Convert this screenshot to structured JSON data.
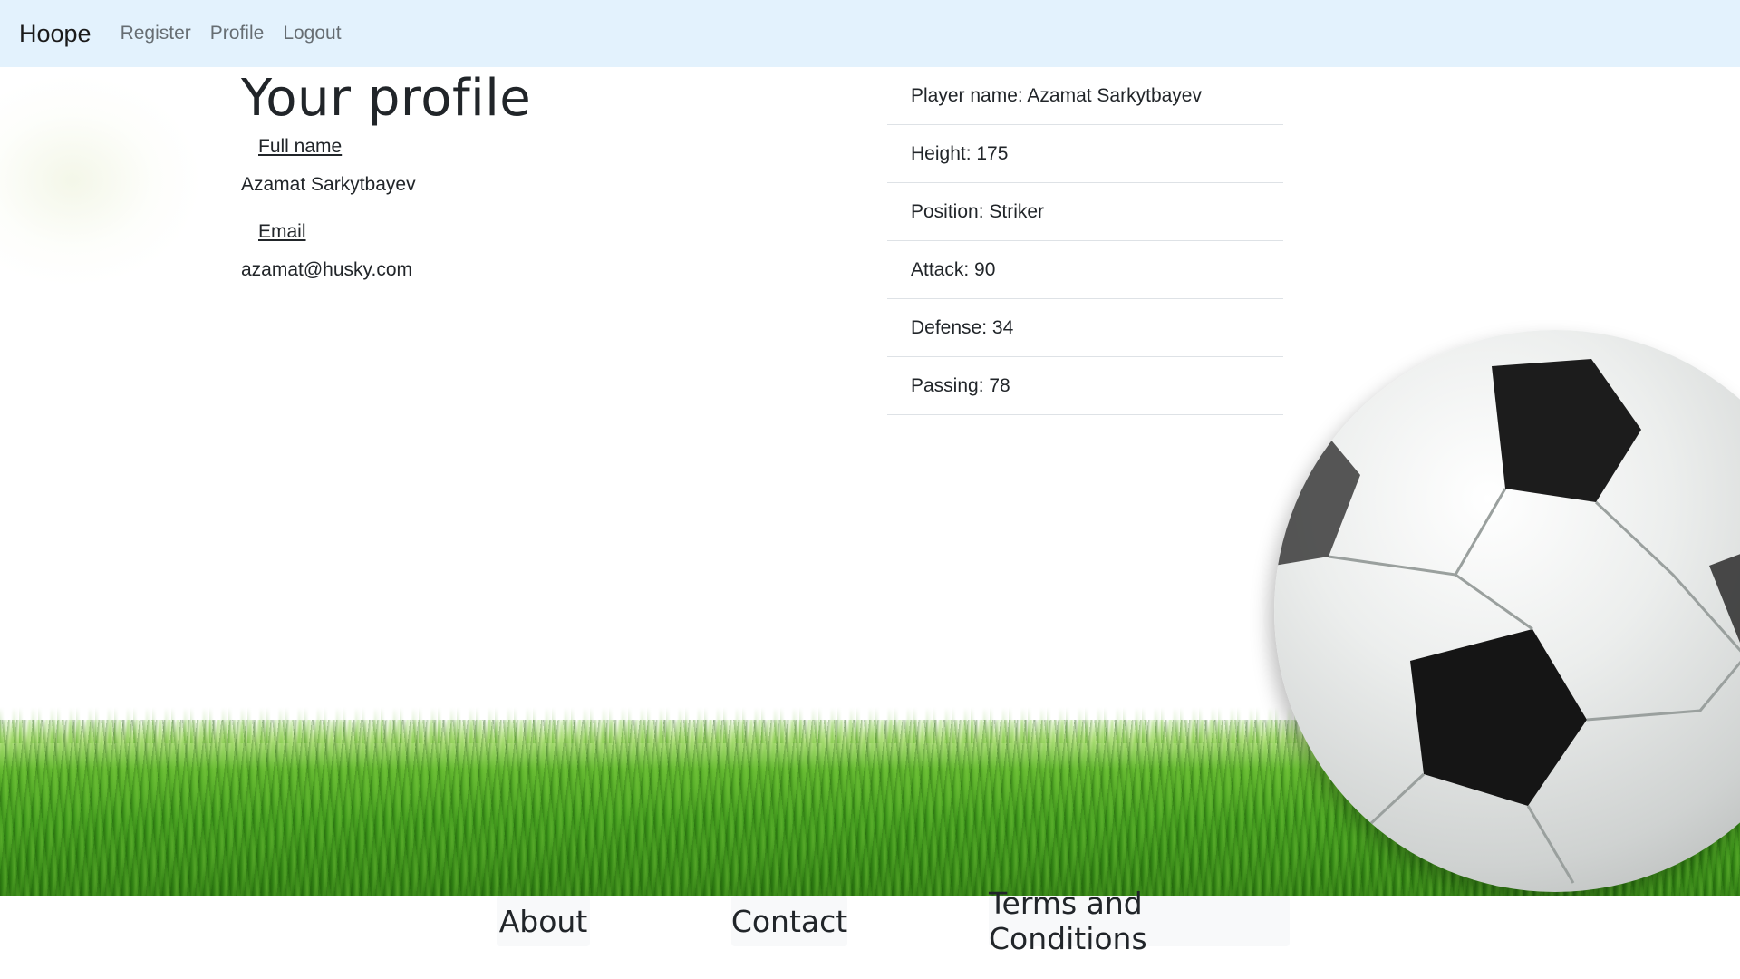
{
  "navbar": {
    "brand": "Hoope",
    "links": [
      "Register",
      "Profile",
      "Logout"
    ]
  },
  "profile": {
    "title": "Your profile",
    "full_name_label": "Full name",
    "full_name_value": "Azamat Sarkytbayev",
    "email_label": "Email",
    "email_value": "azamat@husky.com"
  },
  "stats": [
    "Player name: Azamat Sarkytbayev",
    "Height: 175",
    "Position: Striker",
    "Attack: 90",
    "Defense: 34",
    "Passing: 78"
  ],
  "footer": {
    "links": [
      "About",
      "Contact",
      "Terms and Conditions"
    ]
  },
  "colors": {
    "navbar_bg": "#e3f2fd",
    "footer_link_bg": "#f8f9fa",
    "divider": "#dee2e6"
  },
  "icons": {
    "background": "soccer-ball-on-grass-image"
  }
}
